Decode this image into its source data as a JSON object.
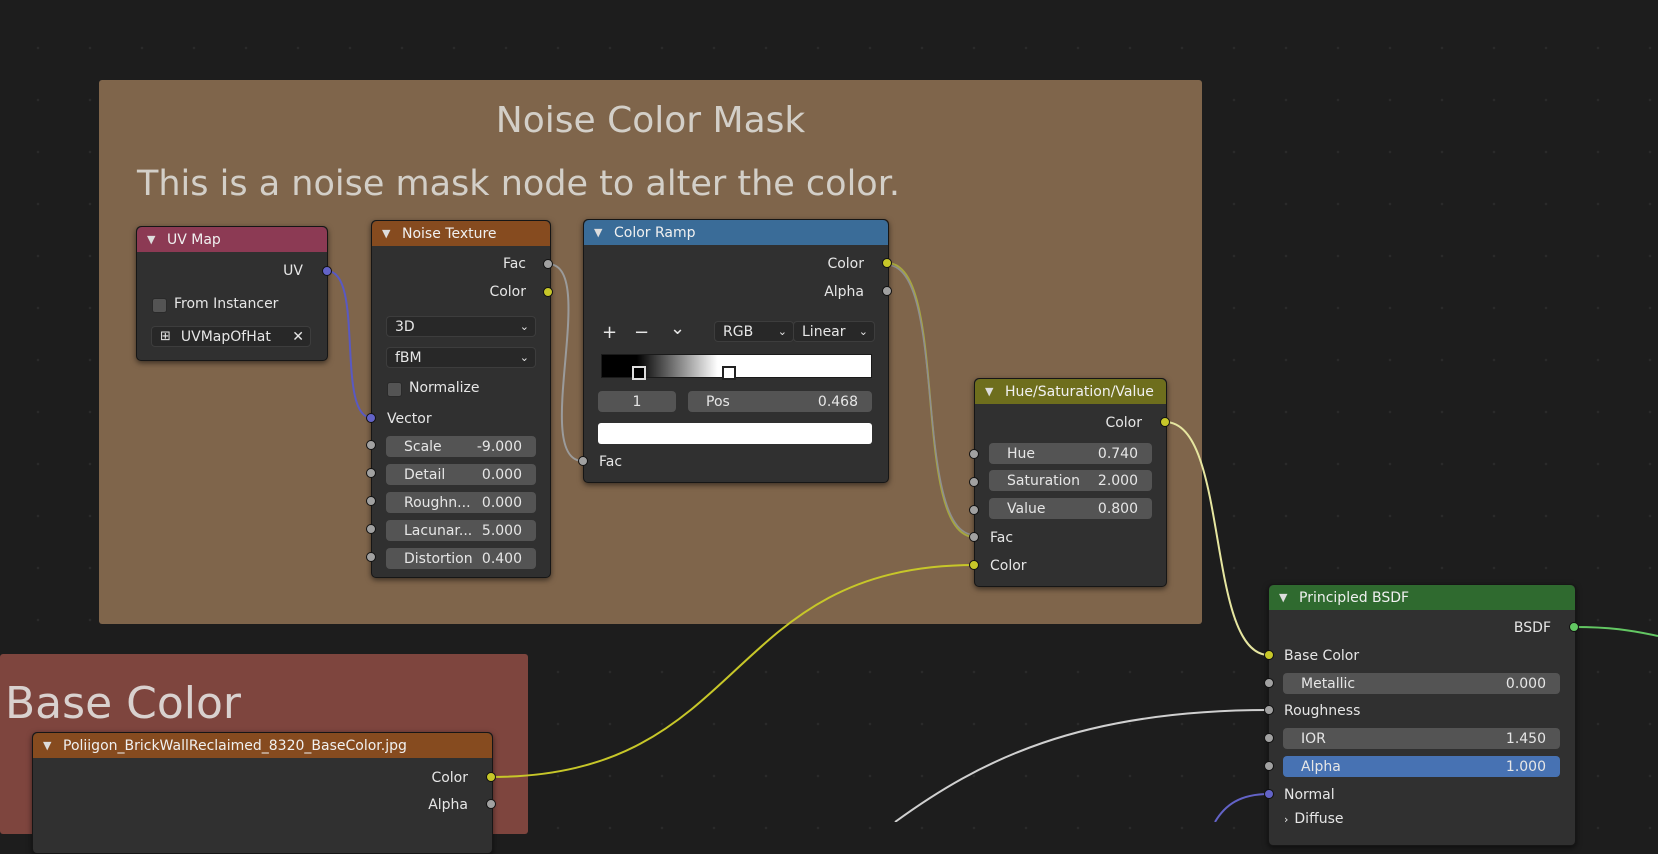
{
  "frames": {
    "noise": {
      "title": "Noise Color Mask",
      "subtitle": "This is a noise mask node to alter the color.",
      "color": "#7f654b"
    },
    "base": {
      "title": "Base Color",
      "color": "#7e453e"
    }
  },
  "uv_map": {
    "title": "UV Map",
    "out_uv": "UV",
    "from_instancer": "From Instancer",
    "map_name": "UVMapOfHat",
    "header_color": "#8c3a54"
  },
  "noise_tex": {
    "title": "Noise Texture",
    "out_fac": "Fac",
    "out_color": "Color",
    "dim": "3D",
    "type": "fBM",
    "normalize": "Normalize",
    "vector": "Vector",
    "fields": [
      {
        "label": "Scale",
        "value": "-9.000"
      },
      {
        "label": "Detail",
        "value": "0.000"
      },
      {
        "label": "Roughn...",
        "value": "0.000"
      },
      {
        "label": "Lacunar...",
        "value": "5.000"
      },
      {
        "label": "Distortion",
        "value": "0.400"
      }
    ]
  },
  "color_ramp": {
    "title": "Color Ramp",
    "out_color": "Color",
    "out_alpha": "Alpha",
    "add": "+",
    "remove": "−",
    "menu": "⌄",
    "color_mode": "RGB",
    "interpolation": "Linear",
    "stop_index": "1",
    "pos_label": "Pos",
    "pos_value": "0.468",
    "in_fac": "Fac"
  },
  "hsv": {
    "title": "Hue/Saturation/Value",
    "out_color": "Color",
    "fields": [
      {
        "label": "Hue",
        "value": "0.740"
      },
      {
        "label": "Saturation",
        "value": "2.000"
      },
      {
        "label": "Value",
        "value": "0.800"
      }
    ],
    "in_fac": "Fac",
    "in_color": "Color"
  },
  "bsdf": {
    "title": "Principled BSDF",
    "out": "BSDF",
    "base_color": "Base Color",
    "metallic": {
      "label": "Metallic",
      "value": "0.000"
    },
    "roughness": "Roughness",
    "ior": {
      "label": "IOR",
      "value": "1.450"
    },
    "alpha": {
      "label": "Alpha",
      "value": "1.000"
    },
    "normal": "Normal",
    "diffuse": "Diffuse"
  },
  "image_tex": {
    "title": "Poliigon_BrickWallReclaimed_8320_BaseColor.jpg",
    "out_color": "Color",
    "out_alpha": "Alpha"
  }
}
